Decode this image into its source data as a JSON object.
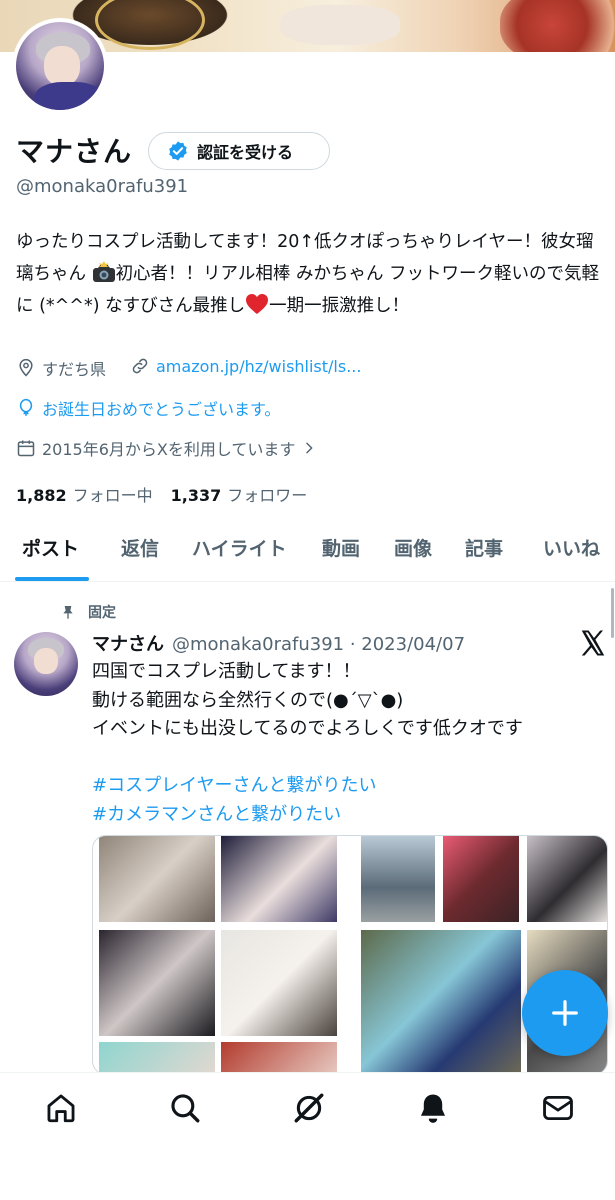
{
  "profile": {
    "name": "マナさん",
    "verify_label": "認証を受ける",
    "handle": "@monaka0rafu391",
    "bio_part1": "ゆったりコスプレ活動してます！20↑低クオぽっちゃりレイヤー！彼女瑠璃ちゃん ",
    "bio_part2": "初心者！！リアル相棒 みかちゃん フットワーク軽いので気軽に (*^^*) なすびさん最推し",
    "bio_part3": "一期一振激推し！",
    "location": "すだち県",
    "link": "amazon.jp/hz/wishlist/ls...",
    "birthday": "お誕生日おめでとうございます。",
    "joined": "2015年6月からXを利用しています",
    "following_count": "1,882",
    "following_label": "フォロー中",
    "followers_count": "1,337",
    "followers_label": "フォロワー"
  },
  "tabs": [
    {
      "label": "ポスト"
    },
    {
      "label": "返信"
    },
    {
      "label": "ハイライト"
    },
    {
      "label": "動画"
    },
    {
      "label": "画像"
    },
    {
      "label": "記事"
    },
    {
      "label": "いいね"
    }
  ],
  "post": {
    "pinned_label": "固定",
    "name": "マナさん",
    "meta": "@monaka0rafu391 · 2023/04/07",
    "lines": [
      "四国でコスプレ活動してます！！",
      "動ける範囲なら全然行くので(●´▽`●)",
      "イベントにも出没してるのでよろしくです低クオです"
    ],
    "hashtags": [
      "#コスプレイヤーさんと繋がりたい",
      "#カメラマンさんと繋がりたい"
    ]
  },
  "icons": {
    "nav": [
      "home-icon",
      "search-icon",
      "grok-icon",
      "notifications-icon",
      "messages-icon"
    ],
    "accent": "#1d9bf0"
  }
}
